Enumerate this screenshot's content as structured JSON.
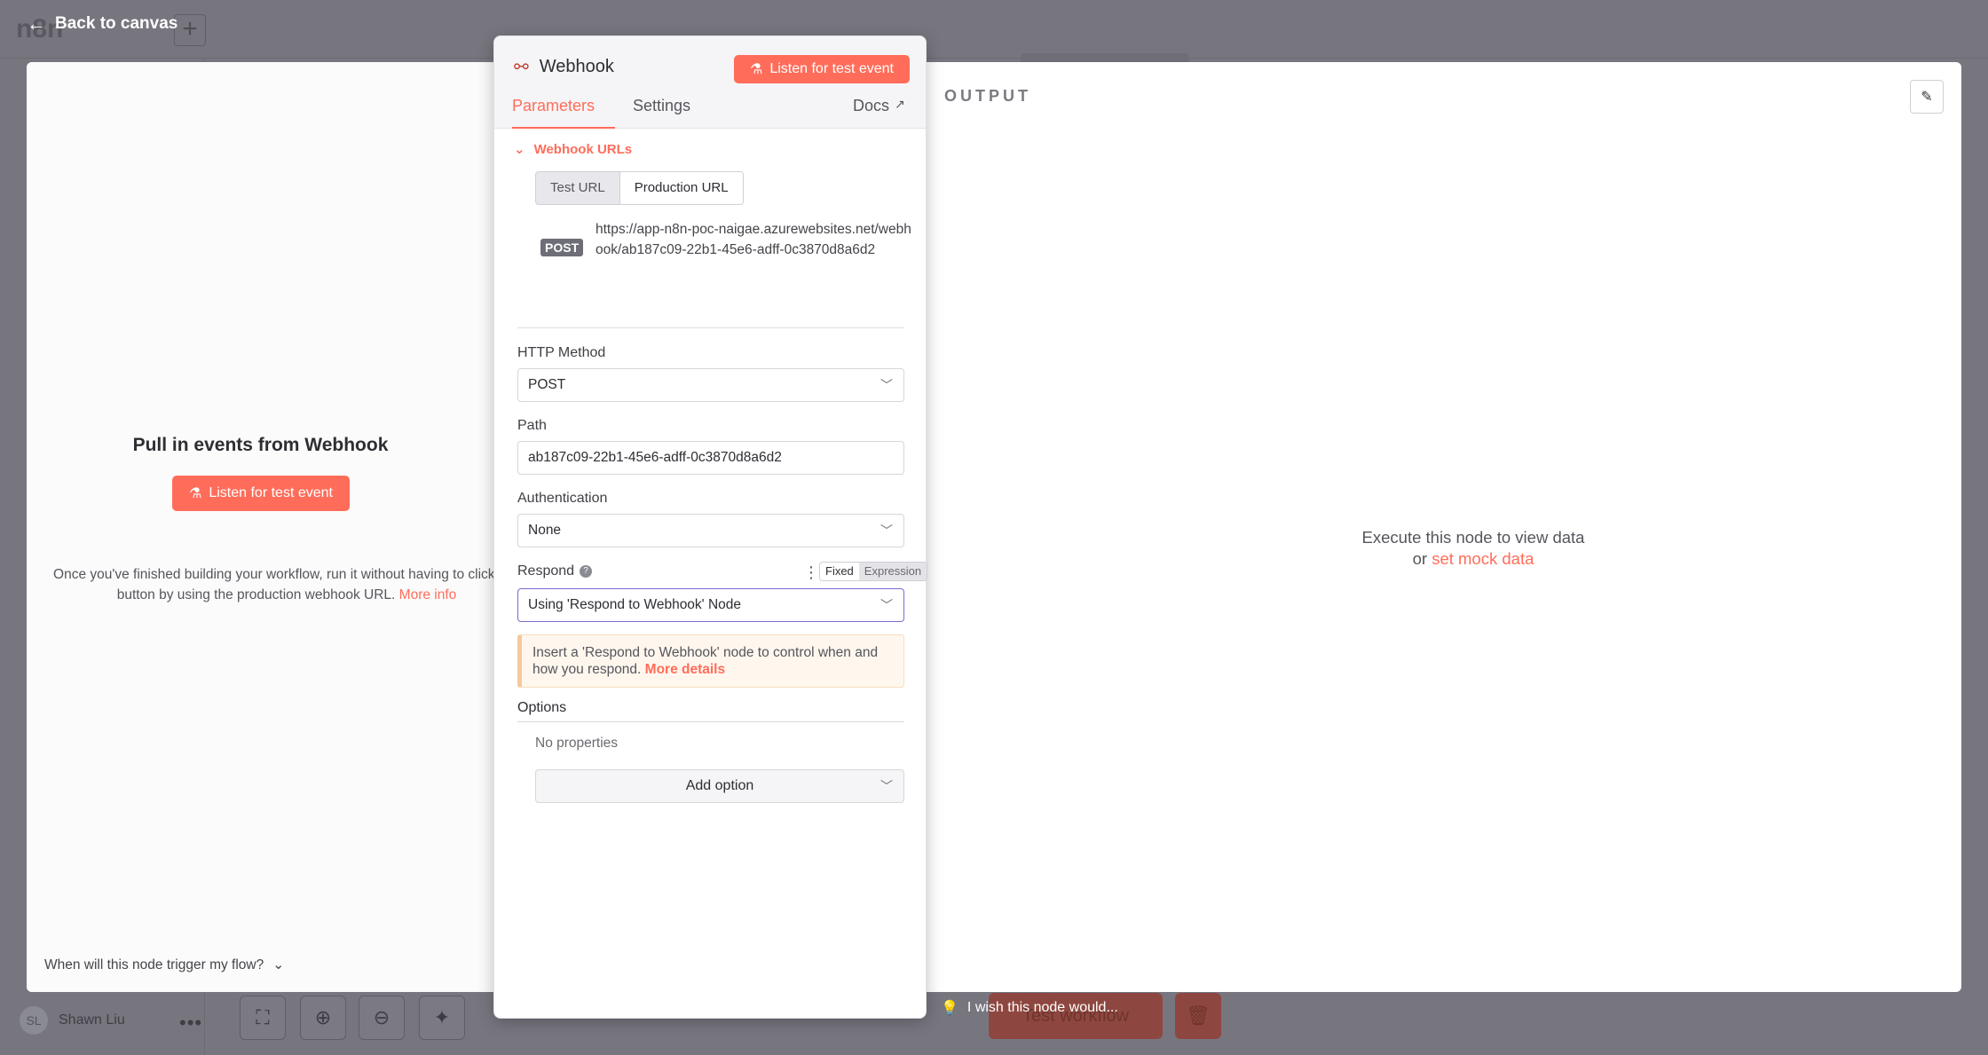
{
  "background": {
    "logo_text": "n8n",
    "user_initials": "SL",
    "user_name": "Shawn Liu",
    "test_workflow_label": "Test workflow"
  },
  "back_link": {
    "label": "Back to canvas"
  },
  "input_pane": {
    "title": "Pull in events from Webhook",
    "listen_button": "Listen for test event",
    "help_text": "Once you've finished building your workflow, run it without having to click this button by using the production webhook URL.",
    "help_link": "More info",
    "trigger_question": "When will this node trigger my flow?"
  },
  "node_panel": {
    "title": "Webhook",
    "listen_button": "Listen for test event",
    "tabs": [
      {
        "label": "Parameters",
        "active": true
      },
      {
        "label": "Settings",
        "active": false
      }
    ],
    "docs_label": "Docs",
    "webhook_urls_label": "Webhook URLs",
    "url_toggle": {
      "test": "Test URL",
      "production": "Production URL",
      "selected": "Production URL"
    },
    "method_badge": "POST",
    "webhook_url": "https://app-n8n-poc-naigae.azurewebsites.net/webhook/ab187c09-22b1-45e6-adff-0c3870d8a6d2",
    "fields": {
      "http_method": {
        "label": "HTTP Method",
        "value": "POST"
      },
      "path": {
        "label": "Path",
        "value": "ab187c09-22b1-45e6-adff-0c3870d8a6d2"
      },
      "authentication": {
        "label": "Authentication",
        "value": "None"
      },
      "respond": {
        "label": "Respond",
        "value": "Using 'Respond to Webhook' Node",
        "mode_fixed": "Fixed",
        "mode_expression": "Expression"
      }
    },
    "notice": {
      "text": "Insert a 'Respond to Webhook' node to control when and how you respond.",
      "link": "More details"
    },
    "options": {
      "label": "Options",
      "empty": "No properties",
      "add_button": "Add option"
    }
  },
  "output_pane": {
    "label": "OUTPUT",
    "empty_line1": "Execute this node to view data",
    "empty_or": "or",
    "mock_link": "set mock data"
  },
  "feedback": {
    "label": "I wish this node would..."
  },
  "colors": {
    "accent": "#ff6d5a",
    "overlay": "#77767f",
    "focus": "#7a6bd0"
  }
}
